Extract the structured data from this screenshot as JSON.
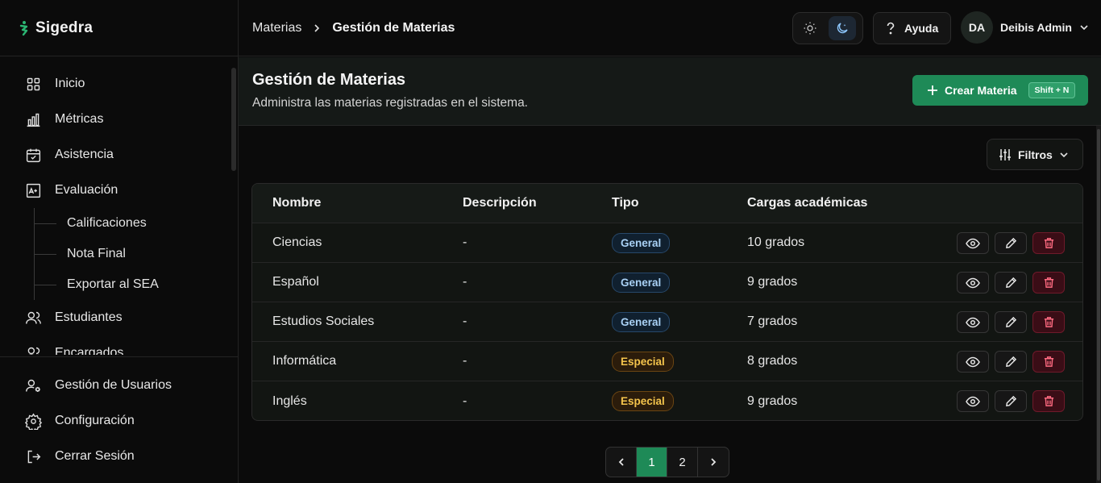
{
  "app": {
    "name": "Sigedra",
    "accent": "#1e8a57"
  },
  "sidebar": {
    "items": [
      {
        "label": "Inicio",
        "icon": "grid-icon"
      },
      {
        "label": "Métricas",
        "icon": "bar-chart-icon"
      },
      {
        "label": "Asistencia",
        "icon": "calendar-check-icon"
      },
      {
        "label": "Evaluación",
        "icon": "grade-icon"
      }
    ],
    "subitems": [
      "Calificaciones",
      "Nota Final",
      "Exportar al SEA"
    ],
    "more_items": [
      {
        "label": "Estudiantes",
        "icon": "users-icon"
      },
      {
        "label": "Encargados",
        "icon": "users-icon"
      }
    ],
    "bottom": [
      {
        "label": "Gestión de Usuarios",
        "icon": "user-cog-icon"
      },
      {
        "label": "Configuración",
        "icon": "gear-icon"
      },
      {
        "label": "Cerrar Sesión",
        "icon": "logout-icon"
      }
    ]
  },
  "header": {
    "breadcrumb_parent": "Materias",
    "breadcrumb_current": "Gestión de Materias",
    "help_label": "Ayuda",
    "user_initials": "DA",
    "user_name": "Deibis Admin"
  },
  "page": {
    "title": "Gestión de Materias",
    "subtitle": "Administra las materias registradas en el sistema.",
    "create_label": "Crear Materia",
    "create_shortcut": "Shift + N",
    "filters_label": "Filtros"
  },
  "table": {
    "columns": [
      "Nombre",
      "Descripción",
      "Tipo",
      "Cargas académicas"
    ],
    "rows": [
      {
        "name": "Ciencias",
        "desc": "-",
        "type": "General",
        "loads": "10 grados"
      },
      {
        "name": "Español",
        "desc": "-",
        "type": "General",
        "loads": "9 grados"
      },
      {
        "name": "Estudios Sociales",
        "desc": "-",
        "type": "General",
        "loads": "7 grados"
      },
      {
        "name": "Informática",
        "desc": "-",
        "type": "Especial",
        "loads": "8 grados"
      },
      {
        "name": "Inglés",
        "desc": "-",
        "type": "Especial",
        "loads": "9 grados"
      }
    ]
  },
  "pagination": {
    "pages": [
      "1",
      "2"
    ],
    "current": "1"
  }
}
